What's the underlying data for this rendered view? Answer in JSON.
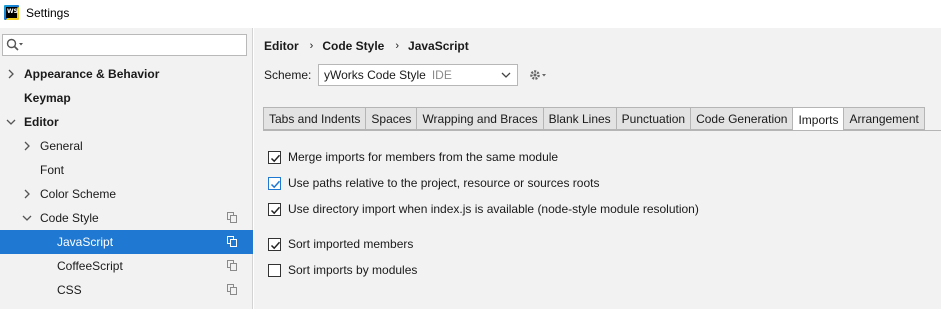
{
  "window": {
    "title": "Settings",
    "icon": "webstorm-app-icon"
  },
  "sidebar": {
    "search": {
      "value": "",
      "placeholder": ""
    },
    "items": [
      {
        "label": "Appearance & Behavior",
        "bold": true,
        "arrow": "right"
      },
      {
        "label": "Keymap",
        "bold": true
      },
      {
        "label": "Editor",
        "bold": true,
        "arrow": "down"
      },
      {
        "label": "General",
        "arrow": "right"
      },
      {
        "label": "Font"
      },
      {
        "label": "Color Scheme",
        "arrow": "right"
      },
      {
        "label": "Code Style",
        "arrow": "down",
        "copy_icon": true
      },
      {
        "label": "JavaScript",
        "selected": true,
        "copy_icon": true
      },
      {
        "label": "CoffeeScript",
        "copy_icon": true
      },
      {
        "label": "CSS",
        "copy_icon": true
      }
    ]
  },
  "breadcrumb": [
    "Editor",
    "Code Style",
    "JavaScript"
  ],
  "breadcrumb_separator": "›",
  "scheme": {
    "label": "Scheme:",
    "value": "yWorks Code Style",
    "suffix": "IDE"
  },
  "tabs": [
    {
      "label": "Tabs and Indents"
    },
    {
      "label": "Spaces"
    },
    {
      "label": "Wrapping and Braces"
    },
    {
      "label": "Blank Lines"
    },
    {
      "label": "Punctuation"
    },
    {
      "label": "Code Generation"
    },
    {
      "label": "Imports",
      "active": true
    },
    {
      "label": "Arrangement"
    }
  ],
  "options": [
    {
      "label": "Merge imports for members from the same module",
      "checked": true
    },
    {
      "label": "Use paths relative to the project, resource or sources roots",
      "checked": true,
      "focused": true
    },
    {
      "label": "Use directory import when index.js is available (node-style module resolution)",
      "checked": true
    },
    {
      "label": "Sort imported members",
      "checked": true
    },
    {
      "label": "Sort imports by modules",
      "checked": false
    }
  ],
  "colors": {
    "selection": "#1f78d1",
    "panel": "#f2f2f2",
    "tab_inactive": "#e3e3e3"
  }
}
